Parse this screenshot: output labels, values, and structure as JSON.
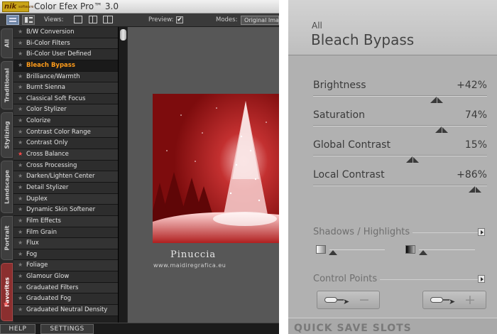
{
  "window": {
    "logo_text": "nik",
    "logo_sub": "software",
    "title": "Color Efex Pro™ 3.0"
  },
  "toolbar": {
    "views_label": "Views:",
    "preview_label": "Preview:",
    "preview_checked": "✔",
    "modes_label": "Modes:",
    "modes_value": "Original Imag"
  },
  "tabs": [
    "All",
    "Traditional",
    "Stylizing",
    "Landscape",
    "Portrait",
    "Favorites"
  ],
  "filters": {
    "selected": "Bleach Bypass",
    "items": [
      "B/W Conversion",
      "Bi-Color Filters",
      "Bi-Color User Defined",
      "Bleach Bypass",
      "Brilliance/Warmth",
      "Burnt Sienna",
      "Classical Soft Focus",
      "Color Stylizer",
      "Colorize",
      "Contrast Color Range",
      "Contrast Only",
      "Cross Balance",
      "Cross Processing",
      "Darken/Lighten Center",
      "Detail Stylizer",
      "Duplex",
      "Dynamic Skin Softener",
      "Film Effects",
      "Film Grain",
      "Flux",
      "Fog",
      "Foliage",
      "Glamour Glow",
      "Graduated Filters",
      "Graduated Fog",
      "Graduated Neutral Density"
    ],
    "favorites": [
      "Cross Balance"
    ]
  },
  "preview": {
    "signature": "Pinuccia",
    "website": "www.maidiregrafica.eu"
  },
  "bottom": {
    "help_label": "HELP",
    "settings_label": "SETTINGS"
  },
  "panel": {
    "category": "All",
    "title": "Bleach Bypass",
    "sliders": [
      {
        "name": "Brightness",
        "value_text": "+42%",
        "level": 0.71
      },
      {
        "name": "Saturation",
        "value_text": "74%",
        "level": 0.74
      },
      {
        "name": "Global Contrast",
        "value_text": "15%",
        "level": 0.57
      },
      {
        "name": "Local Contrast",
        "value_text": "+86%",
        "level": 0.93
      }
    ],
    "shadows_highlights_label": "Shadows / Highlights",
    "control_points_label": "Control Points",
    "cp_remove_sign": "−",
    "cp_add_sign": "+",
    "quick_save_label": "QUICK SAVE SLOTS"
  },
  "colors": {
    "selected_filter": "#ff9c1a",
    "favorite_star": "#ff4a4a",
    "favorites_tab": "#8b2f2f"
  }
}
